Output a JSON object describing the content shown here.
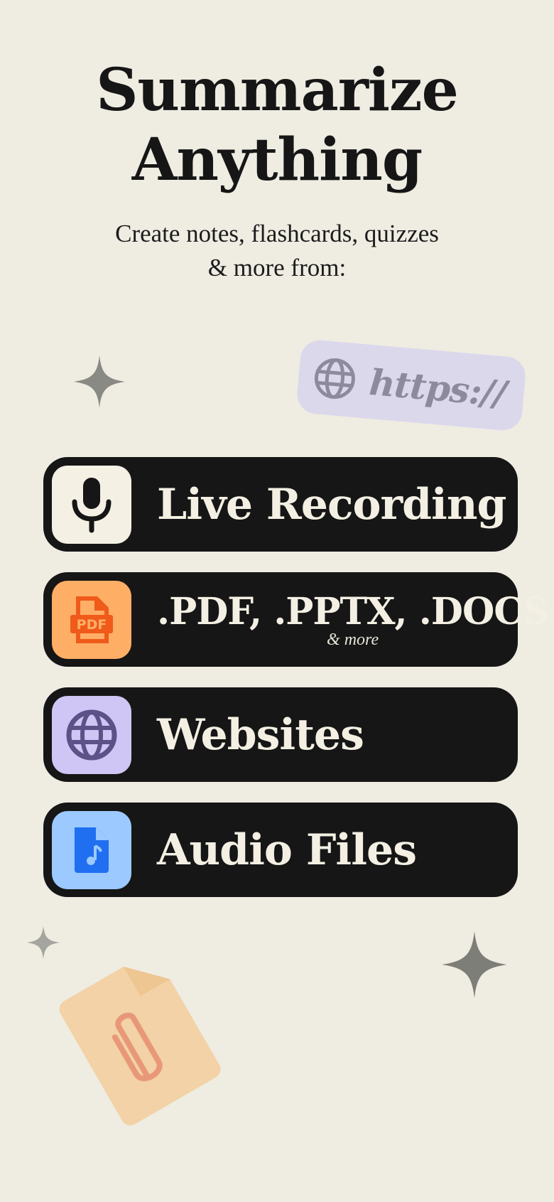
{
  "hero": {
    "title_line1": "Summarize",
    "title_line2": "Anything",
    "subtitle_line1": "Create notes, flashcards, quizzes",
    "subtitle_line2": "& more from:"
  },
  "url_chip": {
    "text": "https://",
    "icon": "globe-icon"
  },
  "sources": [
    {
      "label": "Live Recording",
      "sublabel": "",
      "icon": "microphone-icon",
      "icon_bg": "#f4f0e4"
    },
    {
      "label": ".PDF, .PPTX, .DOCS",
      "sublabel": "& more",
      "icon": "pdf-file-icon",
      "icon_bg": "#ffae66"
    },
    {
      "label": "Websites",
      "sublabel": "",
      "icon": "globe-icon",
      "icon_bg": "#cfc6f5"
    },
    {
      "label": "Audio Files",
      "sublabel": "",
      "icon": "audio-file-icon",
      "icon_bg": "#9cc9ff"
    }
  ],
  "colors": {
    "background": "#efece2",
    "card": "#161616",
    "card_text": "#f3efe3",
    "sparkle": "#8a8a84",
    "pdf_orange": "#f05a1a",
    "globe_purple": "#5d5287",
    "audio_blue": "#1f6ff0"
  },
  "decorations": {
    "sparkles": [
      "sparkle-icon",
      "sparkle-icon",
      "sparkle-icon"
    ],
    "paper": "paperclip-icon"
  }
}
